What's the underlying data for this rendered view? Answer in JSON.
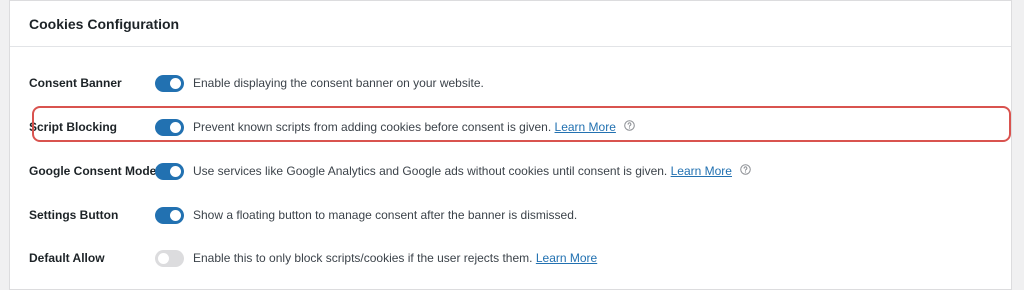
{
  "panel": {
    "title": "Cookies Configuration"
  },
  "settings": [
    {
      "label": "Consent Banner",
      "enabled": true,
      "description": "Enable displaying the consent banner on your website.",
      "link": "",
      "help_icon": false
    },
    {
      "label": "Script Blocking",
      "enabled": true,
      "description": "Prevent known scripts from adding cookies before consent is given.",
      "link": "Learn More",
      "help_icon": true
    },
    {
      "label": "Google Consent Mode",
      "enabled": true,
      "description": "Use services like Google Analytics and Google ads without cookies until consent is given.",
      "link": "Learn More",
      "help_icon": true
    },
    {
      "label": "Settings Button",
      "enabled": true,
      "description": "Show a floating button to manage consent after the banner is dismissed.",
      "link": "",
      "help_icon": false
    },
    {
      "label": "Default Allow",
      "enabled": false,
      "description": "Enable this to only block scripts/cookies if the user rejects them.",
      "link": "Learn More",
      "help_icon": false
    }
  ],
  "colors": {
    "accent": "#2271b1",
    "toggle_off": "#dcdcde",
    "highlight": "#d9534f"
  },
  "icons": {
    "help": "question-circle-icon"
  }
}
